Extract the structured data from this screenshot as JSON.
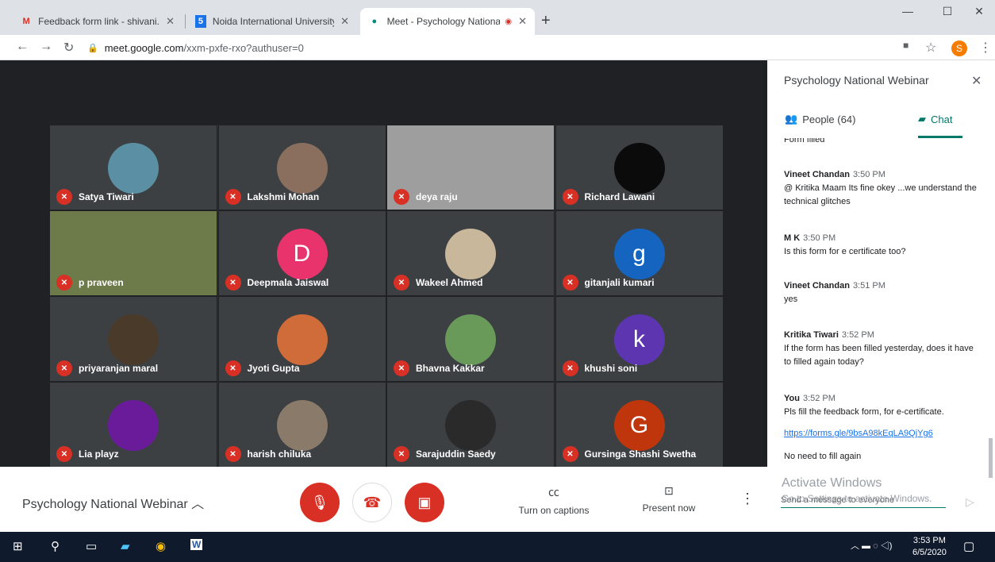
{
  "tabs": [
    {
      "title": "Feedback form link - shivani.tom",
      "icon": "gmail-icon"
    },
    {
      "title": "Noida International University - C",
      "icon": "calendar-icon"
    },
    {
      "title": "Meet - Psychology National",
      "icon": "meet-icon"
    }
  ],
  "url": {
    "host": "meet.google.com",
    "path": "/xxm-pxfe-rxo?authuser=0"
  },
  "profile_initial": "S",
  "participants": [
    {
      "name": "Satya Tiwari",
      "color": "#5b8fa3"
    },
    {
      "name": "Lakshmi Mohan",
      "color": "#8b6f5e"
    },
    {
      "name": "deya raju",
      "color": "#9e9e9e",
      "video": true
    },
    {
      "name": "Richard Lawani",
      "color": "#0b0b0b"
    },
    {
      "name": "p praveen",
      "color": "#6d7a4a",
      "video": true
    },
    {
      "name": "Deepmala Jaiswal",
      "letter": "D",
      "color": "#e8336d"
    },
    {
      "name": "Wakeel Ahmed",
      "color": "#c9b79c"
    },
    {
      "name": "gitanjali kumari",
      "letter": "g",
      "color": "#1565c0"
    },
    {
      "name": "priyaranjan maral",
      "color": "#4a3a2a"
    },
    {
      "name": "Jyoti Gupta",
      "color": "#d06b3a"
    },
    {
      "name": "Bhavna Kakkar",
      "color": "#6a9a5a"
    },
    {
      "name": "khushi soni",
      "letter": "k",
      "color": "#5e35b1"
    },
    {
      "name": "Lia playz",
      "color": "#6a1b9a"
    },
    {
      "name": "harish chiluka",
      "color": "#8a7a6a"
    },
    {
      "name": "Sarajuddin Saedy",
      "color": "#2a2a2a"
    },
    {
      "name": "Gursinga Shashi Swetha",
      "letter": "G",
      "color": "#bf360c"
    }
  ],
  "meeting": {
    "title": "Psychology National Webinar"
  },
  "controls": {
    "captions": "Turn on captions",
    "present": "Present now"
  },
  "panel": {
    "title": "Psychology National Webinar",
    "people": "People (64)",
    "chat": "Chat",
    "partial": "Form filled",
    "messages": [
      {
        "who": "Vineet Chandan",
        "time": "3:50 PM",
        "text": "@ Kritika Maam Its fine okey ...we understand the technical glitches"
      },
      {
        "who": "M K",
        "time": "3:50 PM",
        "text": "Is this form for e certificate too?"
      },
      {
        "who": "Vineet Chandan",
        "time": "3:51 PM",
        "text": "yes"
      },
      {
        "who": "Kritika Tiwari",
        "time": "3:52 PM",
        "text": "If the form has been filled yesterday, does it have to filled again today?"
      },
      {
        "who": "You",
        "time": "3:52 PM",
        "text": "Pls fill the feedback form, for e-certificate."
      }
    ],
    "link": "https://forms.gle/9bsA98kEqLA9QjYg6",
    "last": "No need to fill again",
    "placeholder": "Send a message to everyone"
  },
  "watermark": {
    "line1": "Activate Windows",
    "line2": "Go to Settings to activate Windows."
  },
  "taskbar": {
    "time": "3:53 PM",
    "date": "6/5/2020"
  }
}
